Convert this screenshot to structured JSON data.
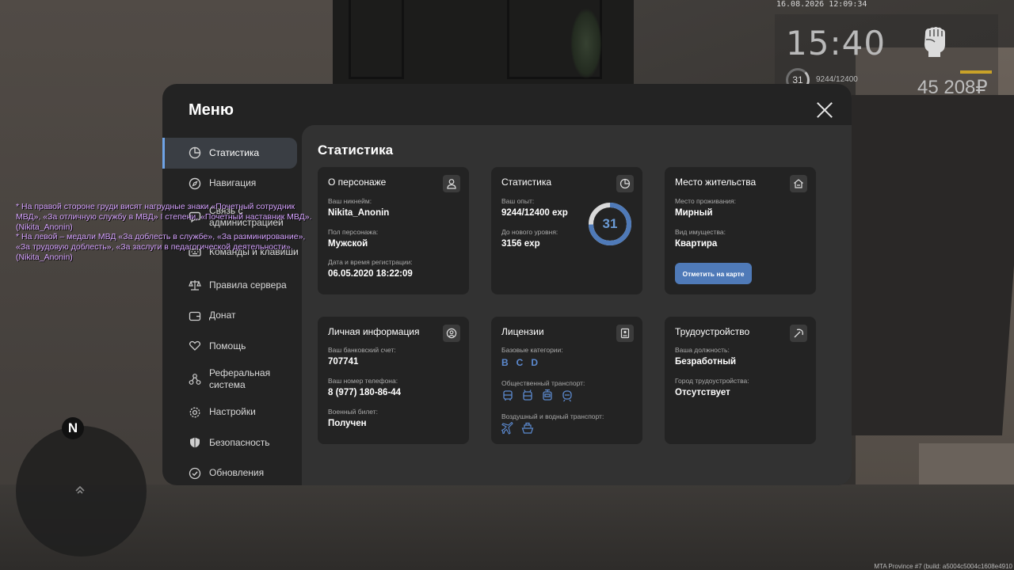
{
  "hud": {
    "datetime": "16.08.2026 12:09:34",
    "time": "15:40",
    "level": "31",
    "exp": "9244/12400",
    "money": "45 208₽"
  },
  "chat": {
    "lines": [
      "* На правой стороне груди висят нагрудные знаки «Почетный сотрудник",
      " МВД», «За отличную службу в МВД» I степени, «Почетный наставник МВД».",
      " (Nikita_Anonin)",
      "* На левой – медали МВД «За доблесть в службе», «За разминирование»,",
      " «За трудовую доблесть», «За заслуги в педагогической деятельности».",
      "(Nikita_Anonin)"
    ]
  },
  "minimap": {
    "north": "N"
  },
  "footer": {
    "build": "MTA Province #7 (build: a5004c5004c1608e4910"
  },
  "menu": {
    "title": "Меню",
    "sidebar": [
      {
        "label": "Статистика",
        "icon": "pie-chart-icon",
        "active": true
      },
      {
        "label": "Навигация",
        "icon": "compass-icon"
      },
      {
        "label": "Связь с администрацией",
        "icon": "message-icon"
      },
      {
        "label": "Команды и клавиши",
        "icon": "keyboard-icon"
      },
      {
        "label": "Правила сервера",
        "icon": "scales-icon"
      },
      {
        "label": "Донат",
        "icon": "wallet-icon"
      },
      {
        "label": "Помощь",
        "icon": "heart-hand-icon"
      },
      {
        "label": "Реферальная система",
        "icon": "network-icon"
      },
      {
        "label": "Настройки",
        "icon": "gear-icon"
      },
      {
        "label": "Безопасность",
        "icon": "shield-icon"
      },
      {
        "label": "Обновления",
        "icon": "check-circle-icon"
      }
    ],
    "content_title": "Статистика",
    "cards": {
      "character": {
        "title": "О персонаже",
        "icon": "user-icon",
        "nickname_label": "Ваш никнейм:",
        "nickname": "Nikita_Anonin",
        "gender_label": "Пол персонажа:",
        "gender": "Мужской",
        "reg_label": "Дата и время регистрации:",
        "reg": "06.05.2020 18:22:09"
      },
      "stats": {
        "title": "Статистика",
        "icon": "clock-pie-icon",
        "exp_label": "Ваш опыт:",
        "exp": "9244/12400 exp",
        "next_label": "До нового уровня:",
        "next": "3156 exp",
        "level": "31",
        "progress": 0.745
      },
      "residence": {
        "title": "Место жительства",
        "icon": "house-icon",
        "place_label": "Место проживания:",
        "place": "Мирный",
        "property_label": "Вид имущества:",
        "property": "Квартира",
        "button": "Отметить на карте"
      },
      "personal": {
        "title": "Личная информация",
        "icon": "user-circle-icon",
        "bank_label": "Ваш банковский счет:",
        "bank": "707741",
        "phone_label": "Ваш номер телефона:",
        "phone": "8 (977) 180-86-44",
        "military_label": "Военный билет:",
        "military": "Получен"
      },
      "licenses": {
        "title": "Лицензии",
        "icon": "id-card-icon",
        "base_label": "Базовые категории:",
        "base": [
          "B",
          "C",
          "D"
        ],
        "public_label": "Общественный транспорт:",
        "air_label": "Воздушный и водный транспорт:"
      },
      "job": {
        "title": "Трудоустройство",
        "icon": "pickaxe-icon",
        "position_label": "Ваша должность:",
        "position": "Безработный",
        "city_label": "Город трудоустройства:",
        "city": "Отсутствует"
      }
    }
  }
}
